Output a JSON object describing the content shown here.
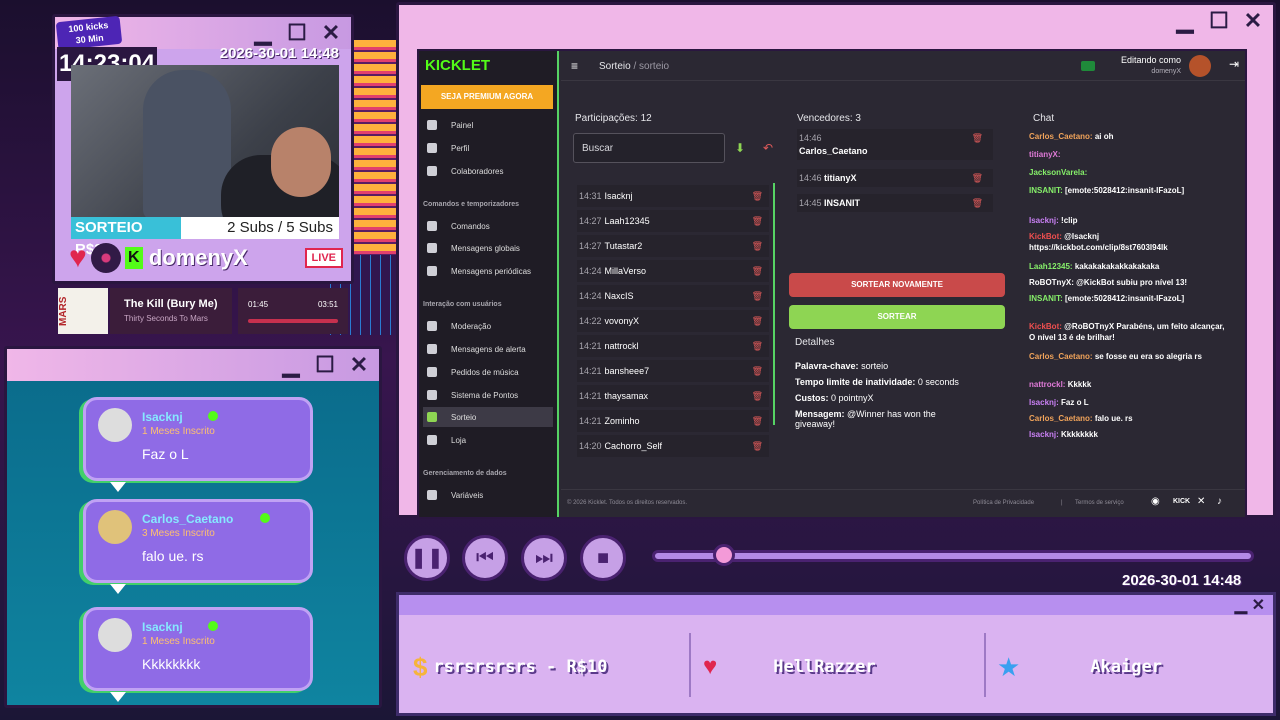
{
  "webcam": {
    "kicks_badge": "100 kicks\n30 Min",
    "kicks_line1": "100 kicks",
    "kicks_line2": "30 Min",
    "clock": "14:23:04",
    "date": "2026-30-01 14:48",
    "sorteio_label": "SORTEIO R$30",
    "subs_label": "2 Subs / 5 Subs",
    "streamer_name": "domenyX",
    "live_label": "LIVE"
  },
  "music": {
    "album_text": "MARS",
    "title": "The Kill (Bury Me)",
    "artist": "Thirty Seconds To Mars",
    "elapsed": "01:45",
    "duration": "03:51"
  },
  "alerts": [
    {
      "user": "Isacknj",
      "sub": "1 Meses Inscrito",
      "message": "Faz o L"
    },
    {
      "user": "Carlos_Caetano",
      "sub": "3 Meses Inscrito",
      "message": "falo ue. rs"
    },
    {
      "user": "Isacknj",
      "sub": "1 Meses Inscrito",
      "message": "Kkkkkkkk"
    }
  ],
  "player": {
    "progress": 0.12,
    "date": "2026-30-01 14:48"
  },
  "bottom_bar": {
    "donation": "rsrsrsrsrs - R$10",
    "follower": "HellRazzer",
    "subscriber": "Akaiger"
  },
  "kicklet": {
    "logo": "KICKLET",
    "premium_button": "SEJA PREMIUM AGORA",
    "nav": {
      "painel": "Painel",
      "perfil": "Perfil",
      "colaboradores": "Colaboradores",
      "section_commands": "Comandos e temporizadores",
      "comandos": "Comandos",
      "mensagens_globais": "Mensagens globais",
      "mensagens_periodicas": "Mensagens periódicas",
      "section_interaction": "Interação com usuários",
      "moderacao": "Moderação",
      "mensagens_alerta": "Mensagens de alerta",
      "pedidos_musica": "Pedidos de música",
      "sistema_pontos": "Sistema de Pontos",
      "sorteio": "Sorteio",
      "loja": "Loja",
      "section_data": "Gerenciamento de dados",
      "variaveis": "Variáveis"
    },
    "breadcrumb_main": "Sorteio",
    "breadcrumb_sep": "/",
    "breadcrumb_sub": "sorteio",
    "editing_label": "Editando como",
    "editing_user": "domenyX",
    "participants_title": "Participações: 12",
    "search_placeholder": "Buscar",
    "participants": [
      {
        "time": "14:31",
        "name": "Isacknj"
      },
      {
        "time": "14:27",
        "name": "Laah12345"
      },
      {
        "time": "14:27",
        "name": "Tutastar2"
      },
      {
        "time": "14:24",
        "name": "MillaVerso"
      },
      {
        "time": "14:24",
        "name": "NaxcIS"
      },
      {
        "time": "14:22",
        "name": "vovonyX"
      },
      {
        "time": "14:21",
        "name": "nattrockl"
      },
      {
        "time": "14:21",
        "name": "bansheee7"
      },
      {
        "time": "14:21",
        "name": "thaysamax"
      },
      {
        "time": "14:21",
        "name": "Zominho"
      },
      {
        "time": "14:20",
        "name": "Cachorro_Self"
      }
    ],
    "winners_title": "Vencedores: 3",
    "winners": [
      {
        "time": "14:46",
        "name": "Carlos_Caetano"
      },
      {
        "time": "14:46",
        "name": "titianyX"
      },
      {
        "time": "14:45",
        "name": "INSANIT"
      }
    ],
    "redraw_button": "SORTEAR NOVAMENTE",
    "draw_button": "SORTEAR",
    "details_title": "Detalhes",
    "details": {
      "keyword_label": "Palavra-chave:",
      "keyword_value": "sorteio",
      "inactivity_label": "Tempo limite de inatividade:",
      "inactivity_value": "0 seconds",
      "cost_label": "Custos:",
      "cost_value": "0 pointnyX",
      "message_label": "Mensagem:",
      "message_value": "@Winner has won the giveaway!"
    },
    "chat_title": "Chat",
    "chat": [
      {
        "user": "Carlos_Caetano:",
        "text": "ai oh",
        "color": "#f0a35a"
      },
      {
        "user": "titianyX:",
        "text": "",
        "color": "#e07ad8"
      },
      {
        "user": "JacksonVarela:",
        "text": "",
        "color": "#86f06a"
      },
      {
        "user": "INSANIT:",
        "text": "[emote:5028412:insanit-IFazoL]",
        "color": "#86f06a"
      },
      {
        "user": "Isacknj:",
        "text": "!clip",
        "color": "#c980f4"
      },
      {
        "user": "KickBot:",
        "text": "@Isacknj https://kickbot.com/clip/8st7603l94lk",
        "color": "#f04f4f"
      },
      {
        "user": "Laah12345:",
        "text": "kakakakakakkakakaka",
        "color": "#86f06a"
      },
      {
        "user": "RoBOTnyX:",
        "text": "@KickBot subiu pro nível 13!",
        "color": "#fff"
      },
      {
        "user": "INSANIT:",
        "text": "[emote:5028412:insanit-IFazoL]",
        "color": "#86f06a"
      },
      {
        "user": "KickBot:",
        "text": "@RoBOTnyX Parabéns, um feito alcançar, O nível 13 é de brilhar!",
        "color": "#f04f4f"
      },
      {
        "user": "Carlos_Caetano:",
        "text": "se fosse eu era so alegria rs",
        "color": "#f0a35a"
      },
      {
        "user": "nattrockl:",
        "text": "Kkkkk",
        "color": "#e07ad8"
      },
      {
        "user": "Isacknj:",
        "text": "Faz o L",
        "color": "#c980f4"
      },
      {
        "user": "Carlos_Caetano:",
        "text": "falo ue. rs",
        "color": "#f0a35a"
      },
      {
        "user": "Isacknj:",
        "text": "Kkkkkkkk",
        "color": "#c980f4"
      }
    ],
    "footer_copyright": "© 2026 Kicklet. Todos os direitos reservados.",
    "footer_privacy": "Política de Privacidade",
    "footer_sep": "|",
    "footer_terms": "Termos de serviço"
  }
}
